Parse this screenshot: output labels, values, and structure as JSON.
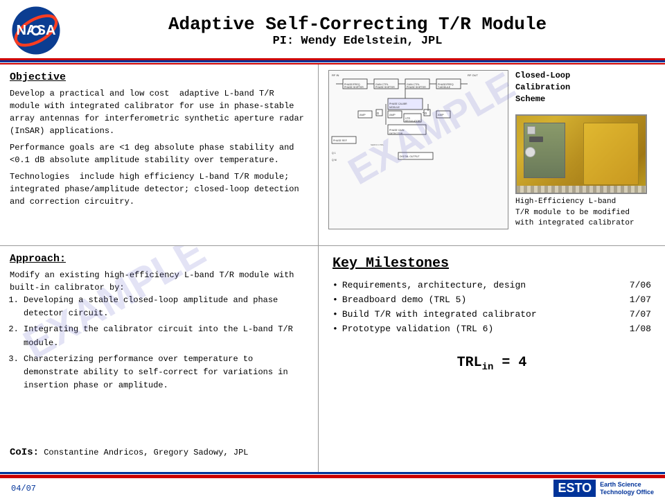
{
  "header": {
    "title": "Adaptive Self-Correcting T/R Module",
    "subtitle": "PI: Wendy Edelstein, JPL"
  },
  "objective": {
    "title": "Objective",
    "paragraphs": [
      "Develop a practical and low cost  adaptive L-band T/R module with integrated calibrator for use in phase-stable array antennas for interferometric synthetic aperture radar (InSAR) applications.",
      "Performance goals are <1 deg absolute phase stability and <0.1 dB absolute amplitude stability over temperature.",
      "Technologies  include high efficiency L-band T/R module; integrated phase/amplitude detector; closed-loop detection and correction circuitry."
    ]
  },
  "diagram": {
    "closed_loop_label": "Closed-Loop\nCalibration\nScheme",
    "module_caption": "High-Efficiency L-band\nT/R module to be modified\nwith integrated calibrator"
  },
  "approach": {
    "title": "Approach:",
    "intro": "Modify an existing high-efficiency L-band T/R module with built-in calibrator by:",
    "steps": [
      "Developing a stable closed-loop amplitude and phase detector circuit.",
      "Integrating the calibrator circuit into the L-band T/R module.",
      "Characterizing performance over temperature to demonstrate ability to self-correct for variations in insertion phase or amplitude."
    ]
  },
  "milestones": {
    "title": "Key Milestones",
    "items": [
      {
        "label": "Requirements, architecture, design",
        "date": "7/06"
      },
      {
        "label": "Breadboard demo (TRL 5)",
        "date": "1/07"
      },
      {
        "label": "Build T/R with integrated calibrator",
        "date": "7/07"
      },
      {
        "label": "Prototype validation (TRL 6)",
        "date": "1/08"
      }
    ],
    "trl_label": "TRL",
    "trl_sub": "in",
    "trl_value": " = 4"
  },
  "cois": {
    "label": "CoIs:",
    "names": "Constantine Andricos, Gregory Sadowy, JPL"
  },
  "footer": {
    "date": "04/07",
    "logo_text": "ESTO",
    "logo_subtext": "Earth Science\nTechnology Office"
  },
  "watermark": "EXAMPLE"
}
